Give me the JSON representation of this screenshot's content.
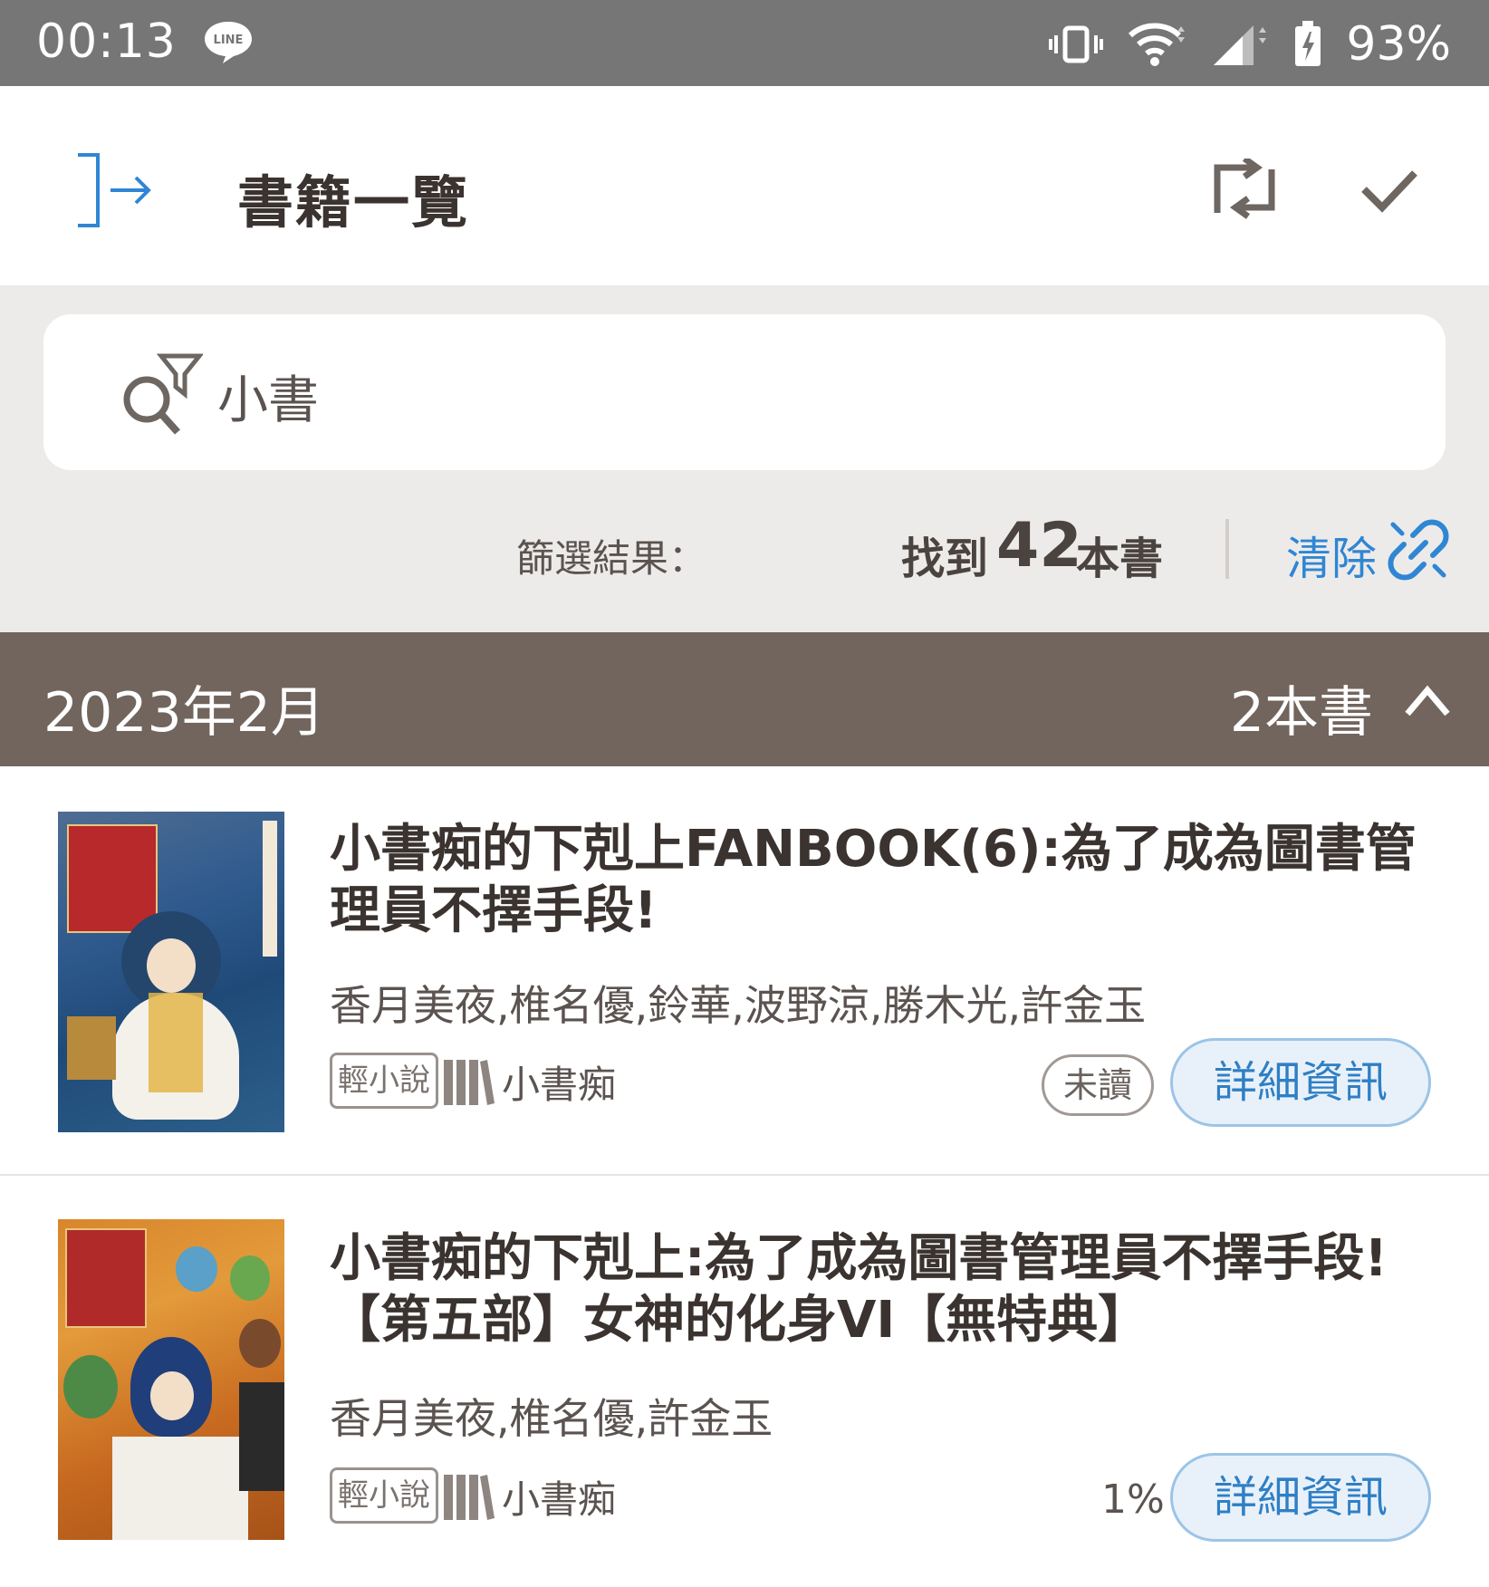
{
  "status_bar": {
    "time": "00:13",
    "line_badge": "LINE",
    "battery_percent": "93%"
  },
  "app_bar": {
    "title": "書籍一覽"
  },
  "search": {
    "value": "小書"
  },
  "filter_result": {
    "label": "篩選結果：",
    "found_prefix": "找到",
    "count": "42",
    "count_unit": "本書",
    "clear_label": "清除"
  },
  "month_group": {
    "title": "2023年2月",
    "count_label": "2本書"
  },
  "books": [
    {
      "title": "小書痴的下剋上FANBOOK(6):為了成為圖書管理員不擇手段!",
      "authors": "香月美夜,椎名優,鈴華,波野涼,勝木光,許金玉",
      "genre": "輕小說",
      "series": "小書痴",
      "status": "未讀",
      "detail_label": "詳細資訊"
    },
    {
      "title": "小書痴的下剋上:為了成為圖書管理員不擇手段!【第五部】女神的化身VI【無特典】",
      "authors": "香月美夜,椎名優,許金玉",
      "genre": "輕小說",
      "series": "小書痴",
      "progress": "1%",
      "detail_label": "詳細資訊"
    }
  ],
  "colors": {
    "status_bar": "#767676",
    "month_header": "#72655e",
    "accent_blue": "#2f86d4",
    "filter_bg": "#edebe9"
  },
  "icons": {
    "exit": "exit-icon",
    "swap": "swap-icon",
    "check": "check-icon",
    "search_filter": "search-filter-icon",
    "clear_link": "unlink-icon",
    "chevron": "chevron-up-icon",
    "series": "books-icon"
  }
}
